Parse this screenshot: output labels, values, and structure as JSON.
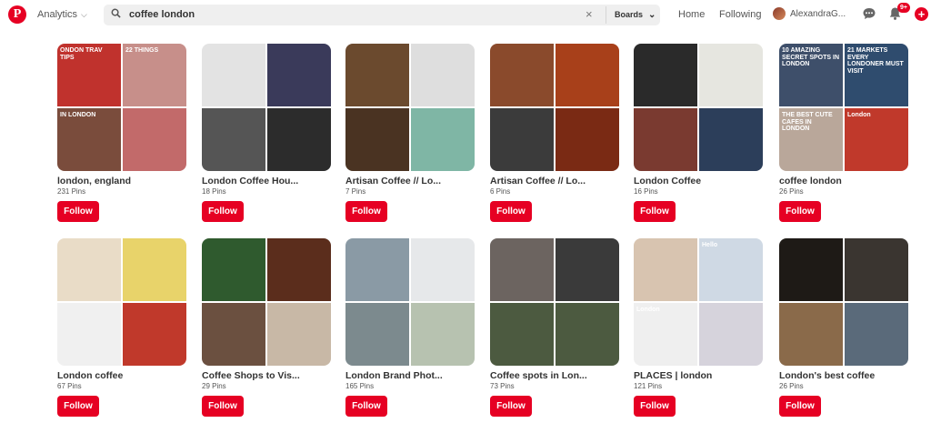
{
  "header": {
    "analytics_label": "Analytics",
    "search_query": "coffee london",
    "search_scope": "Boards",
    "nav_home": "Home",
    "nav_following": "Following",
    "user_name": "AlexandraG...",
    "notification_count": "9+",
    "brand_color": "#e60023"
  },
  "boards": [
    {
      "name": "london, england",
      "pins": "231 Pins",
      "follow": "Follow",
      "tiles": [
        {
          "bg": "#c0322d",
          "text": "ONDON TRAV TIPS"
        },
        {
          "bg": "#c78f8a",
          "text": "22 THINGS"
        },
        {
          "bg": "#7a4c3c",
          "text": "IN LONDON"
        },
        {
          "bg": "#c26a6a",
          "text": ""
        }
      ]
    },
    {
      "name": "London Coffee Hou...",
      "pins": "18 Pins",
      "follow": "Follow",
      "tiles": [
        {
          "bg": "#e3e3e3",
          "text": ""
        },
        {
          "bg": "#3a3a5a",
          "text": ""
        },
        {
          "bg": "#555555",
          "text": ""
        },
        {
          "bg": "#2c2c2c",
          "text": ""
        }
      ]
    },
    {
      "name": "Artisan Coffee // Lo...",
      "pins": "7 Pins",
      "follow": "Follow",
      "tiles": [
        {
          "bg": "#6b4a2e",
          "text": ""
        },
        {
          "bg": "#dedede",
          "text": ""
        },
        {
          "bg": "#4a3322",
          "text": ""
        },
        {
          "bg": "#7fb6a5",
          "text": ""
        }
      ]
    },
    {
      "name": "Artisan Coffee // Lo...",
      "pins": "6 Pins",
      "follow": "Follow",
      "tiles": [
        {
          "bg": "#8a4a2c",
          "text": ""
        },
        {
          "bg": "#a8401a",
          "text": ""
        },
        {
          "bg": "#3b3b3b",
          "text": ""
        },
        {
          "bg": "#7a2a14",
          "text": ""
        }
      ]
    },
    {
      "name": "London Coffee",
      "pins": "16 Pins",
      "follow": "Follow",
      "tiles": [
        {
          "bg": "#2a2a2a",
          "text": ""
        },
        {
          "bg": "#e6e6e0",
          "text": ""
        },
        {
          "bg": "#7a3a30",
          "text": ""
        },
        {
          "bg": "#2c3e5a",
          "text": ""
        }
      ]
    },
    {
      "name": "coffee london",
      "pins": "26 Pins",
      "follow": "Follow",
      "tiles": [
        {
          "bg": "#3e4f6a",
          "text": "10 AMAZING SECRET SPOTS IN LONDON"
        },
        {
          "bg": "#2f4c6e",
          "text": "21 MARKETS EVERY LONDONER MUST VISIT"
        },
        {
          "bg": "#b9a79a",
          "text": "THE BEST CUTE CAFES IN LONDON"
        },
        {
          "bg": "#c0392b",
          "text": "London"
        }
      ]
    },
    {
      "name": "London coffee",
      "pins": "67 Pins",
      "follow": "Follow",
      "tiles": [
        {
          "bg": "#e9dcc7",
          "text": ""
        },
        {
          "bg": "#e8d36a",
          "text": ""
        },
        {
          "bg": "#f0f0f0",
          "text": ""
        },
        {
          "bg": "#c0392b",
          "text": ""
        }
      ]
    },
    {
      "name": "Coffee Shops to Vis...",
      "pins": "29 Pins",
      "follow": "Follow",
      "tiles": [
        {
          "bg": "#2f5a2e",
          "text": ""
        },
        {
          "bg": "#5b2d1c",
          "text": ""
        },
        {
          "bg": "#6b5040",
          "text": ""
        },
        {
          "bg": "#c8b8a6",
          "text": ""
        }
      ]
    },
    {
      "name": "London Brand Phot...",
      "pins": "165 Pins",
      "follow": "Follow",
      "tiles": [
        {
          "bg": "#8a9aa5",
          "text": ""
        },
        {
          "bg": "#e6e8ea",
          "text": ""
        },
        {
          "bg": "#7c8a8e",
          "text": ""
        },
        {
          "bg": "#b7c2b0",
          "text": ""
        }
      ]
    },
    {
      "name": "Coffee spots in Lon...",
      "pins": "73 Pins",
      "follow": "Follow",
      "tiles": [
        {
          "bg": "#6c6460",
          "text": ""
        },
        {
          "bg": "#3a3a3a",
          "text": ""
        },
        {
          "bg": "#4c5a40",
          "text": ""
        },
        {
          "bg": "#4c5a40",
          "text": ""
        }
      ]
    },
    {
      "name": "PLACES | london",
      "pins": "121 Pins",
      "follow": "Follow",
      "tiles": [
        {
          "bg": "#d8c4b0",
          "text": ""
        },
        {
          "bg": "#cfd9e4",
          "text": "Hello"
        },
        {
          "bg": "#efefef",
          "text": "London"
        },
        {
          "bg": "#d6d3dc",
          "text": ""
        }
      ]
    },
    {
      "name": "London's best coffee",
      "pins": "26 Pins",
      "follow": "Follow",
      "tiles": [
        {
          "bg": "#1e1a16",
          "text": ""
        },
        {
          "bg": "#3a3530",
          "text": ""
        },
        {
          "bg": "#8a6a4a",
          "text": ""
        },
        {
          "bg": "#5a6a7a",
          "text": ""
        }
      ]
    }
  ]
}
